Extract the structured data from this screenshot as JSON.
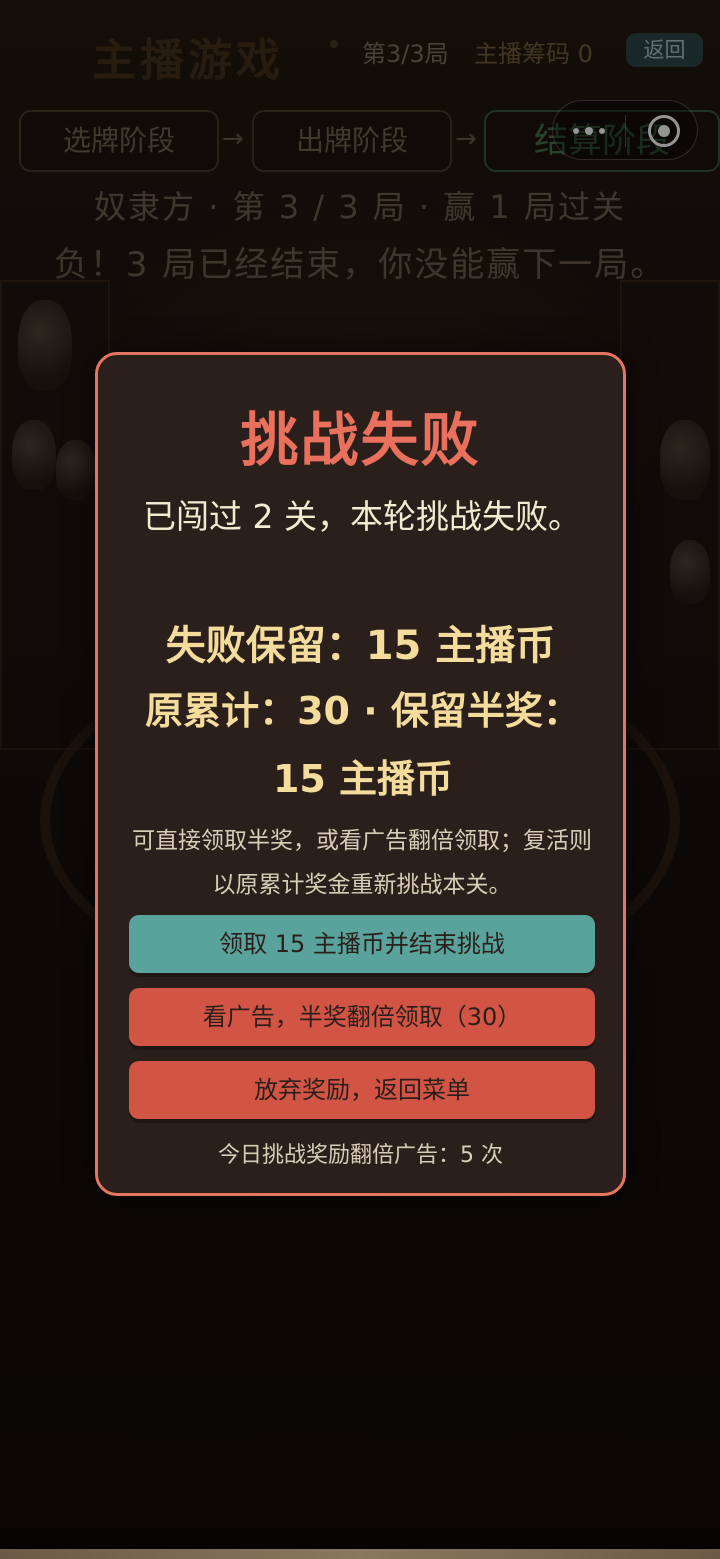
{
  "header": {
    "title": "主播游戏",
    "round_info": "第3/3局",
    "chips_info": "主播筹码 0",
    "back_label": "返回"
  },
  "phases": [
    {
      "label": "选牌阶段",
      "active": false
    },
    {
      "label": "出牌阶段",
      "active": false
    },
    {
      "label": "结算阶段",
      "active": true
    }
  ],
  "status": {
    "subtitle": "奴隶方 · 第 3 / 3 局 · 赢 1 局过关",
    "result_line": "负！3 局已经结束，你没能赢下一局。"
  },
  "modal": {
    "title": "挑战失败",
    "description": "已闯过 2 关，本轮挑战失败。",
    "keep_line": "失败保留：15 主播币",
    "original_line": "原累计：30 · 保留半奖：15 主播币",
    "hint": "可直接领取半奖，或看广告翻倍领取；复活则以原累计奖金重新挑战本关。",
    "claim_button": "领取 15 主播币并结束挑战",
    "ad_button": "看广告，半奖翻倍领取（30）",
    "quit_button": "放弃奖励，返回菜单",
    "ad_count": "今日挑战奖励翻倍广告：5 次"
  },
  "colors": {
    "accent": "#e37660",
    "title": "#e8705c",
    "reward_text": "#f4dc9c",
    "teal_button": "#5aa39c",
    "red_button": "#d15445",
    "modal_bg": "#2b1f1b"
  },
  "icons": {
    "capsule_more": "more-dots-icon",
    "capsule_close": "target-circle-icon"
  }
}
